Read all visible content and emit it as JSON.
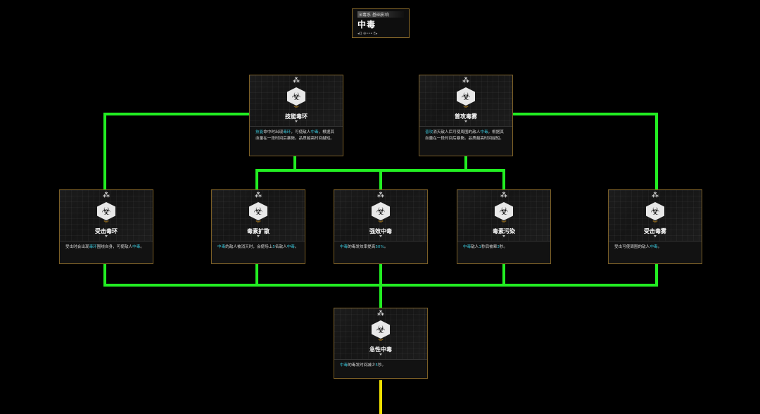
{
  "header": {
    "category": "※毒系 基础影响",
    "title": "中毒",
    "controls": "◂Q  ⊕•••  E▸"
  },
  "nodes": {
    "top_left": {
      "name": "技能毒环",
      "desc": [
        [
          "技能",
          "hl"
        ],
        [
          "命中时出现",
          ""
        ],
        [
          "毒环",
          "hl"
        ],
        [
          "，可使敌人",
          ""
        ],
        [
          "中毒",
          "hl"
        ],
        [
          "，根据其血量在一段时间后暴毙。品质越高时间越短。",
          ""
        ]
      ],
      "icon": "biohazard-skull-icon"
    },
    "top_right": {
      "name": "普攻毒雾",
      "desc": [
        [
          "普攻",
          "hl"
        ],
        [
          "消灭敌人后可使周围的敌人",
          ""
        ],
        [
          "中毒",
          "hl"
        ],
        [
          "，根据其血量在一段时间后暴毙。品质越高时间越短。",
          ""
        ]
      ],
      "icon": "biohazard-mask-icon"
    },
    "mid_1": {
      "name": "受击毒环",
      "desc": [
        [
          "受击时会出现",
          ""
        ],
        [
          "毒环",
          "hl"
        ],
        [
          "围绕自身，可使敌人",
          ""
        ],
        [
          "中毒",
          "hl"
        ],
        [
          "。",
          ""
        ]
      ],
      "icon": "biohazard-skull-icon"
    },
    "mid_2": {
      "name": "毒素扩散",
      "desc": [
        [
          "中毒",
          "hl"
        ],
        [
          "的敌人被消灭时，会使场上",
          ""
        ],
        [
          "5",
          "hl"
        ],
        [
          "名敌人",
          ""
        ],
        [
          "中毒",
          "hl"
        ],
        [
          "。",
          ""
        ]
      ],
      "icon": "biohazard-mask-icon"
    },
    "mid_3": {
      "name": "强效中毒",
      "desc": [
        [
          "中毒",
          "hl"
        ],
        [
          "的毒发效率提高",
          ""
        ],
        [
          "50%",
          "hl"
        ],
        [
          "。",
          ""
        ]
      ],
      "icon": "biohazard-mask-icon"
    },
    "mid_4": {
      "name": "毒素污染",
      "desc": [
        [
          "中毒",
          "hl"
        ],
        [
          "敌人",
          ""
        ],
        [
          "1",
          "hl"
        ],
        [
          "秒后被晕",
          ""
        ],
        [
          "3",
          "hl"
        ],
        [
          "秒。",
          ""
        ]
      ],
      "icon": "biohazard-mask-icon"
    },
    "mid_5": {
      "name": "受击毒雾",
      "desc": [
        [
          "受击可使周围的敌人",
          ""
        ],
        [
          "中毒",
          "hl"
        ],
        [
          "。",
          ""
        ]
      ],
      "icon": "biohazard-mask-icon"
    },
    "bottom": {
      "name": "急性中毒",
      "desc": [
        [
          "中毒",
          "hl"
        ],
        [
          "的毒发时间减少",
          ""
        ],
        [
          "5",
          "hl"
        ],
        [
          "秒。",
          ""
        ]
      ],
      "icon": "biohazard-mask-icon"
    }
  },
  "colors": {
    "wire_active": "#22ee22",
    "wire_next": "#f0e000",
    "highlight": "#39c4d8",
    "border": "#7a5e26"
  }
}
